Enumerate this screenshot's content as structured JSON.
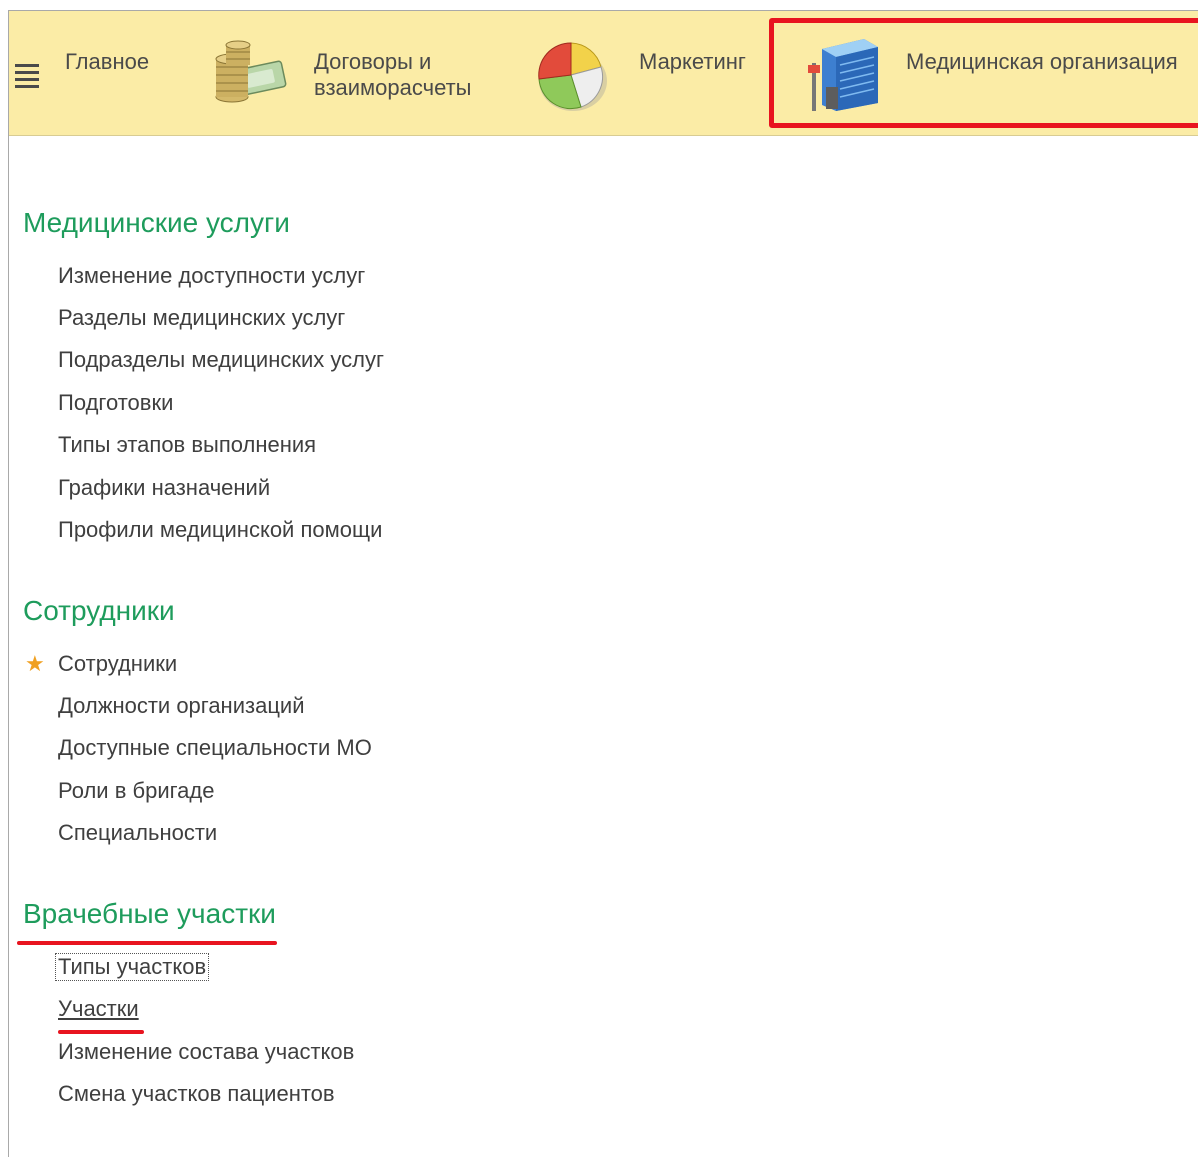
{
  "topbar": {
    "items": [
      {
        "label": "Главное",
        "icon": "hamburger-menu-icon"
      },
      {
        "label_line1": "Договоры и",
        "label_line2": "взаиморасчеты",
        "icon": "coins-money-icon"
      },
      {
        "label": "Маркетинг",
        "icon": "pie-chart-icon"
      },
      {
        "label": "Медицинская организация",
        "icon": "hospital-building-icon"
      }
    ],
    "colors": {
      "background": "#fbeca6",
      "highlight": "#e8141f"
    }
  },
  "sections": [
    {
      "title": "Медицинские услуги",
      "links": [
        "Изменение доступности услуг",
        "Разделы медицинских услуг",
        "Подразделы медицинских услуг",
        "Подготовки",
        "Типы этапов выполнения",
        "Графики назначений",
        "Профили медицинской помощи"
      ]
    },
    {
      "title": "Сотрудники",
      "links": [
        "Сотрудники",
        "Должности организаций",
        "Доступные специальности МО",
        "Роли в бригаде",
        "Специальности"
      ]
    },
    {
      "title": "Врачебные участки",
      "links": [
        "Типы участков",
        "Участки",
        "Изменение состава участков",
        "Смена участков пациентов"
      ]
    }
  ],
  "colors": {
    "section_title": "#1e9c5c",
    "favorite_star": "#f0a020",
    "annotation": "#e8141f"
  }
}
